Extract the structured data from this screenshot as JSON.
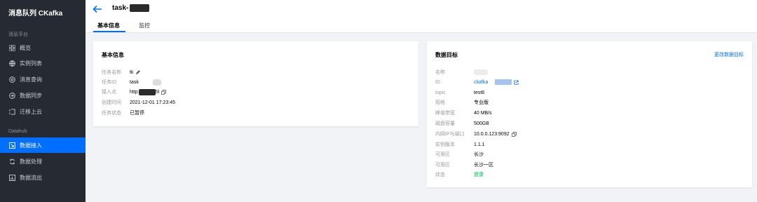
{
  "sidebar": {
    "title": "消息队列 CKafka",
    "section1": "消息平台",
    "items1": [
      {
        "label": "概览",
        "icon": "grid-icon"
      },
      {
        "label": "实例列表",
        "icon": "globe-icon"
      },
      {
        "label": "消息查询",
        "icon": "at-icon"
      },
      {
        "label": "数据同步",
        "icon": "sync-icon"
      },
      {
        "label": "迁移上云",
        "icon": "migrate-icon"
      }
    ],
    "section2": "Datahub",
    "items2": [
      {
        "label": "数据接入",
        "icon": "import-icon",
        "active": true
      },
      {
        "label": "数据处理",
        "icon": "process-icon"
      },
      {
        "label": "数据流出",
        "icon": "export-icon"
      }
    ]
  },
  "header": {
    "task_title_prefix": "task-",
    "tabs": [
      {
        "label": "基本信息",
        "active": true
      },
      {
        "label": "监控",
        "active": false
      }
    ]
  },
  "basic_info": {
    "title": "基本信息",
    "rows": [
      {
        "label": "任务名称",
        "value": "tk"
      },
      {
        "label": "任务ID",
        "value": "task"
      },
      {
        "label": "接入点",
        "value_prefix": "http",
        "value_suffix": "5l"
      },
      {
        "label": "创建时间",
        "value": "2021-12-01 17:23:45"
      },
      {
        "label": "任务状态",
        "value": "已暂停"
      }
    ]
  },
  "data_target": {
    "title": "数据目标",
    "edit_link": "更改数据目标",
    "rows": [
      {
        "label": "名称",
        "value": ""
      },
      {
        "label": "ID",
        "value": "ckafka"
      },
      {
        "label": "topic",
        "value": "test6"
      },
      {
        "label": "规格",
        "value": "专业版"
      },
      {
        "label": "峰值带宽",
        "value": "40 MB/s"
      },
      {
        "label": "磁盘容量",
        "value": "500GB"
      },
      {
        "label": "内网IP与端口",
        "value": "10.0.0.123:9092"
      },
      {
        "label": "实例版本",
        "value": "1.1.1"
      },
      {
        "label": "可用区",
        "value": "长沙"
      },
      {
        "label": "可用区",
        "value": "长沙一区"
      },
      {
        "label": "状态",
        "value": "健康"
      }
    ]
  },
  "colors": {
    "accent": "#006eff",
    "sidebar_bg": "#252a33",
    "healthy": "#0abf5b"
  }
}
